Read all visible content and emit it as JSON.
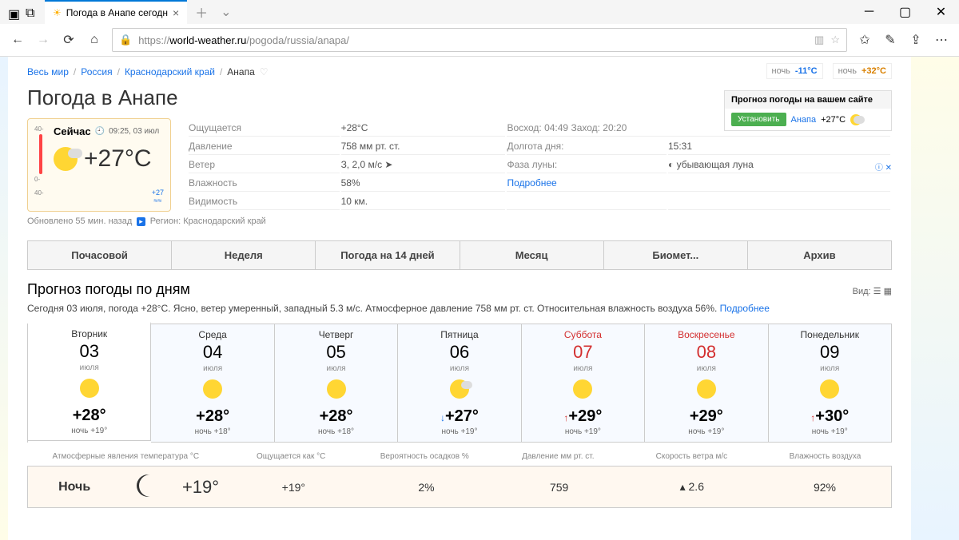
{
  "browser": {
    "tab_title": "Погода в Анапе сегодн",
    "url_domain": "world-weather.ru",
    "url_path": "/pogoda/russia/anapa/",
    "url_prefix": "https://"
  },
  "breadcrumbs": {
    "world": "Весь мир",
    "country": "Россия",
    "region": "Краснодарский край",
    "city": "Анапа"
  },
  "page_title": "Погода в Анапе",
  "extremes": {
    "cold_label": "ночь",
    "cold_val": "-11°C",
    "hot_label": "ночь",
    "hot_val": "+32°C"
  },
  "current": {
    "now_label": "Сейчас",
    "time": "09:25, 03 июл",
    "temp": "+27°C",
    "water": "+27",
    "scale_top": "40-",
    "scale_mid": "0-",
    "scale_bot": "40-"
  },
  "details": {
    "feels_label": "Ощущается",
    "feels": "+28°C",
    "pressure_label": "Давление",
    "pressure": "758 мм рт. ст.",
    "wind_label": "Ветер",
    "wind": "З, 2,0 м/с ➤",
    "humidity_label": "Влажность",
    "humidity": "58%",
    "visibility_label": "Видимость",
    "visibility": "10 км.",
    "sun_label": "Восход: 04:49 Заход: 20:20",
    "daylength_label": "Долгота дня:",
    "daylength": "15:31",
    "moon_label": "Фаза луны:",
    "moon": "убывающая луна",
    "more": "Подробнее"
  },
  "updated": {
    "text": "Обновлено 55 мин. назад",
    "region_label": "Регион: Краснодарский край"
  },
  "widget": {
    "title": "Прогноз погоды на вашем сайте",
    "install": "Установить",
    "city": "Анапа",
    "temp": "+27°C"
  },
  "tabs": {
    "hourly": "Почасовой",
    "week": "Неделя",
    "d14": "Погода на 14 дней",
    "month": "Месяц",
    "bio": "Биомет...",
    "archive": "Архив"
  },
  "forecast": {
    "heading": "Прогноз погоды по дням",
    "view_label": "Вид:",
    "summary": "Сегодня 03 июля, погода +28°C. Ясно, ветер умеренный, западный 5.3 м/с. Атмосферное давление 758 мм рт. ст. Относительная влажность воздуха 56%. ",
    "more": "Подробнее"
  },
  "days": [
    {
      "dow": "Вторник",
      "num": "03",
      "month": "июля",
      "hi": "+28°",
      "lo": "ночь +19°",
      "arrow": "",
      "weekend": false,
      "cloudy": false,
      "active": true
    },
    {
      "dow": "Среда",
      "num": "04",
      "month": "июля",
      "hi": "+28°",
      "lo": "ночь +18°",
      "arrow": "",
      "weekend": false,
      "cloudy": false,
      "active": false
    },
    {
      "dow": "Четверг",
      "num": "05",
      "month": "июля",
      "hi": "+28°",
      "lo": "ночь +18°",
      "arrow": "",
      "weekend": false,
      "cloudy": false,
      "active": false
    },
    {
      "dow": "Пятница",
      "num": "06",
      "month": "июля",
      "hi": "+27°",
      "lo": "ночь +19°",
      "arrow": "down",
      "weekend": false,
      "cloudy": true,
      "active": false
    },
    {
      "dow": "Суббота",
      "num": "07",
      "month": "июля",
      "hi": "+29°",
      "lo": "ночь +19°",
      "arrow": "up",
      "weekend": true,
      "cloudy": false,
      "active": false
    },
    {
      "dow": "Воскресенье",
      "num": "08",
      "month": "июля",
      "hi": "+29°",
      "lo": "ночь +19°",
      "arrow": "",
      "weekend": true,
      "cloudy": false,
      "active": false
    },
    {
      "dow": "Понедельник",
      "num": "09",
      "month": "июля",
      "hi": "+30°",
      "lo": "ночь +19°",
      "arrow": "up",
      "weekend": false,
      "cloudy": false,
      "active": false
    }
  ],
  "metrics": {
    "m1": "Атмосферные явления температура °C",
    "m2": "Ощущается как °C",
    "m3": "Вероятность осадков %",
    "m4": "Давление мм рт. ст.",
    "m5": "Скорость ветра м/с",
    "m6": "Влажность воздуха"
  },
  "night": {
    "label": "Ночь",
    "temp": "+19°",
    "feels": "+19°",
    "precip": "2%",
    "pressure": "759",
    "wind": "2.6",
    "humidity": "92%"
  }
}
